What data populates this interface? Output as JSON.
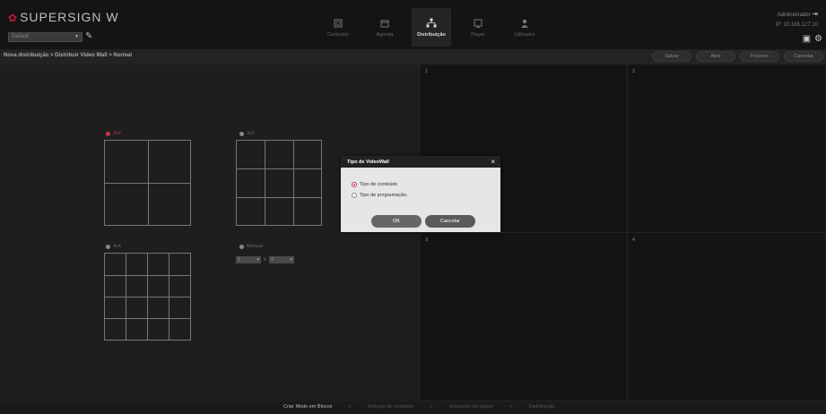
{
  "app": {
    "logo_text": "SUPERSIGN W",
    "workspace_value": "Default",
    "admin_user": "Administrador",
    "admin_ip": "IP: 10.186.127.10"
  },
  "nav": [
    {
      "label": "Conteúdo",
      "icon": "content-icon",
      "active": false
    },
    {
      "label": "Agenda",
      "icon": "calendar-icon",
      "active": false
    },
    {
      "label": "Distribuição",
      "icon": "distribution-icon",
      "active": true
    },
    {
      "label": "Player",
      "icon": "player-icon",
      "active": false
    },
    {
      "label": "Utilizador",
      "icon": "user-icon",
      "active": false
    }
  ],
  "breadcrumb": "Nova distribuição > Distribuir Video Wall > Normal",
  "actions": {
    "save": "Salvar",
    "open": "Abrir",
    "next": "Próximo",
    "cancel": "Cancelar"
  },
  "layouts": {
    "opt_2x2": "2x2",
    "opt_3x3": "3x3",
    "opt_4x4": "4x4",
    "opt_manual": "Manual",
    "selected": "2x2",
    "manual_rows": "2",
    "manual_cols": "2",
    "manual_times": "x"
  },
  "screens": [
    "1",
    "2",
    "3",
    "4"
  ],
  "footer": {
    "step1": "Criar Modo em Blocos",
    "step2": "Seleção de conteúdo",
    "step3": "Selecione um player",
    "step4": "Distribuição",
    "sep": ">"
  },
  "modal": {
    "title": "Tipo de VideoWall",
    "close": "×",
    "option1": "Tipo de conteúdo",
    "option2": "Tipo de programação.",
    "selected": "option1",
    "ok": "OK",
    "cancel": "Cancelar"
  },
  "colors": {
    "accent": "#c8334f",
    "background": "#1c1c1c"
  }
}
